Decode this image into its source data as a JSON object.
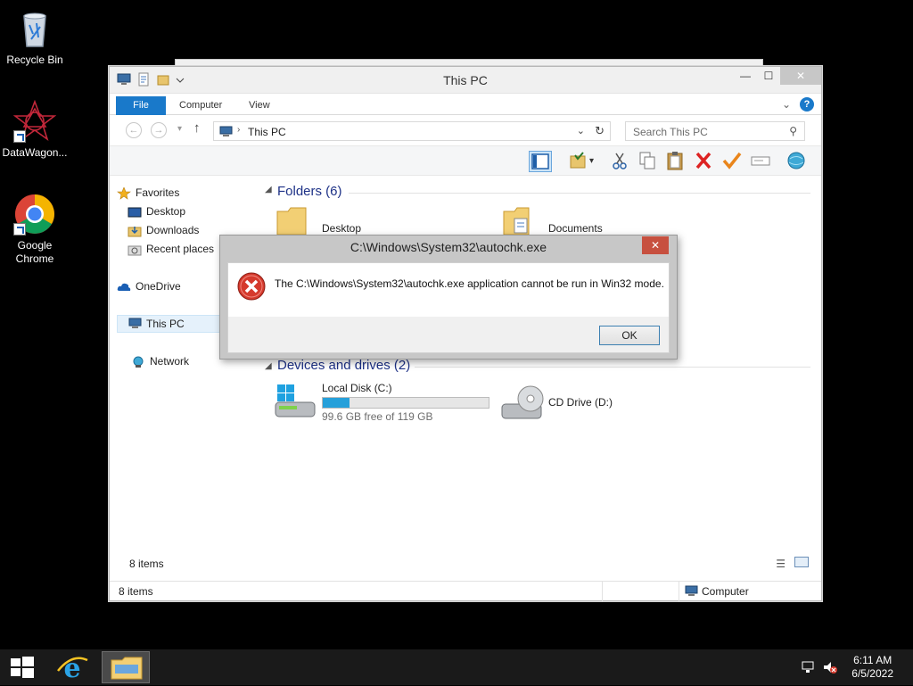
{
  "desktop": {
    "icons": [
      {
        "label": "Recycle Bin"
      },
      {
        "label": "DataWagon..."
      },
      {
        "label": "Google Chrome"
      }
    ]
  },
  "explorer": {
    "title": "This PC",
    "tabs": {
      "file": "File",
      "computer": "Computer",
      "view": "View"
    },
    "address": "This PC",
    "search_placeholder": "Search This PC",
    "nav": {
      "favorites": "Favorites",
      "desktop": "Desktop",
      "downloads": "Downloads",
      "recent": "Recent places",
      "onedrive": "OneDrive",
      "thispc": "This PC",
      "network": "Network"
    },
    "folders_header": "Folders (6)",
    "folders": [
      "Desktop",
      "Documents"
    ],
    "devices_header": "Devices and drives (2)",
    "drives": [
      {
        "name": "Local Disk (C:)",
        "free": "99.6 GB free of 119 GB",
        "used_fraction": 0.16
      },
      {
        "name": "CD Drive (D:)"
      }
    ],
    "item_count_inner": "8 items",
    "status_left": "8 items",
    "status_right": "Computer"
  },
  "dialog": {
    "title": "C:\\Windows\\System32\\autochk.exe",
    "message": "The C:\\Windows\\System32\\autochk.exe application cannot be run in Win32 mode.",
    "ok_label": "OK",
    "close_label": "✕"
  },
  "taskbar": {
    "time": "6:11 AM",
    "date": "6/5/2022"
  }
}
